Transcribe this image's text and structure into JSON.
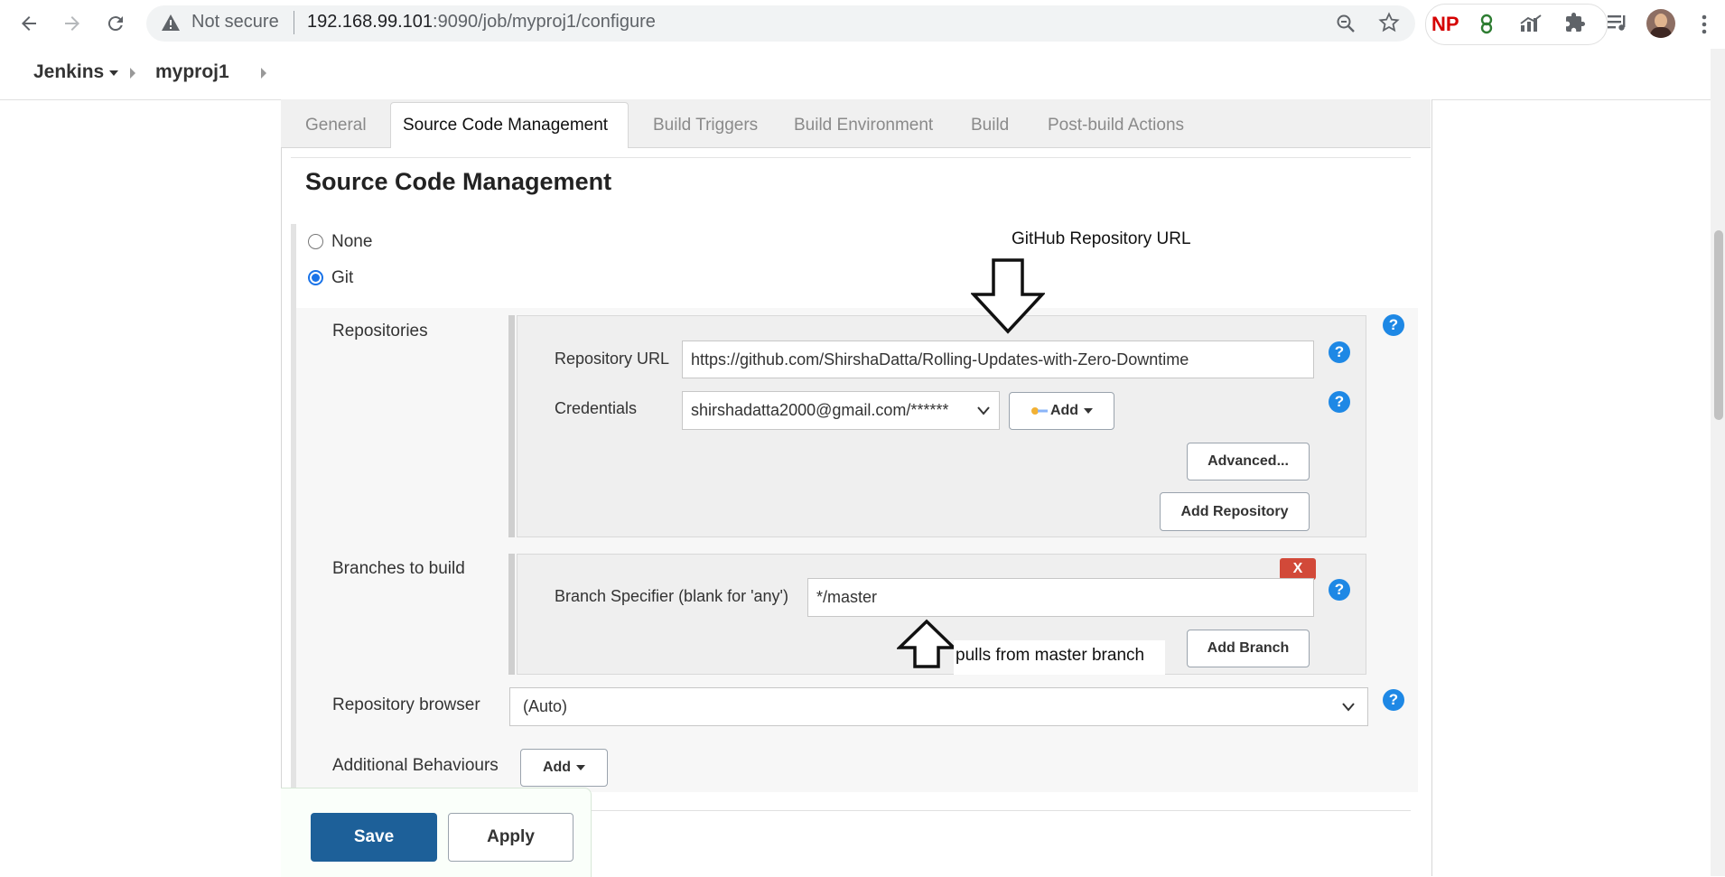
{
  "browser": {
    "security_label": "Not secure",
    "url_host": "192.168.99.101",
    "url_rest": ":9090/job/myproj1/configure",
    "extensions": [
      "NP"
    ]
  },
  "breadcrumb": {
    "items": [
      "Jenkins",
      "myproj1"
    ]
  },
  "tabs": [
    "General",
    "Source Code Management",
    "Build Triggers",
    "Build Environment",
    "Build",
    "Post-build Actions"
  ],
  "section": {
    "title": "Source Code Management",
    "options": [
      "None",
      "Git"
    ],
    "selected": "Git"
  },
  "repositories": {
    "label": "Repositories",
    "url_label": "Repository URL",
    "url_value": "https://github.com/ShirshaDatta/Rolling-Updates-with-Zero-Downtime",
    "credentials_label": "Credentials",
    "credentials_value": "shirshadatta2000@gmail.com/******",
    "add_label": "Add",
    "advanced_label": "Advanced...",
    "add_repository_label": "Add Repository"
  },
  "branches": {
    "label": "Branches to build",
    "specifier_label": "Branch Specifier (blank for 'any')",
    "specifier_value": "*/master",
    "delete_label": "X",
    "add_branch_label": "Add Branch"
  },
  "repo_browser": {
    "label": "Repository browser",
    "value": "(Auto)"
  },
  "additional": {
    "label": "Additional Behaviours",
    "add_label": "Add"
  },
  "footer": {
    "save_label": "Save",
    "apply_label": "Apply"
  },
  "annotations": {
    "github_url": "GitHub Repository URL",
    "master_branch": "pulls from master branch"
  },
  "help_glyph": "?",
  "colors": {
    "save": "#1d6099",
    "help": "#1e88e5",
    "delete": "#d24939",
    "radio_selected": "#1a73e8"
  }
}
